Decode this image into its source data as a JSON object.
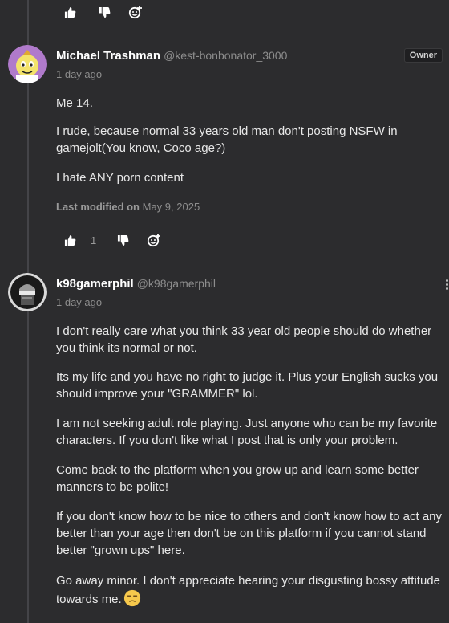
{
  "top_reactions": {
    "like_icon": "thumbs-up-icon",
    "dislike_icon": "thumbs-down-icon",
    "add_reaction_icon": "add-reaction-icon"
  },
  "comments": [
    {
      "display_name": "Michael Trashman",
      "username": "@kest-bonbonator_3000",
      "timestamp": "1 day ago",
      "badge": "Owner",
      "paragraphs": [
        "Me 14.",
        "I rude, because normal 33 years old man don't posting NSFW in gamejolt(You know, Coco age?)",
        "I hate ANY porn content"
      ],
      "modified_label": "Last modified on",
      "modified_date": "May 9, 2025",
      "like_count": "1"
    },
    {
      "display_name": "k98gamerphil",
      "username": "@k98gamerphil",
      "timestamp": "1 day ago",
      "paragraphs": [
        "I don't really care what you think 33 year old people should do whether you think its normal or not.",
        "Its my life and you have no right to judge it. Plus your English sucks you should improve your \"GRAMMER\" lol.",
        "I am not seeking adult role playing. Just anyone who can be my favorite characters. If you don't like what I post that is only your problem.",
        "Come back to the platform when you grow up and learn some better manners to be polite!",
        "If you don't know how to be nice to others and don't know how to act any better than your age then don't be on this platform if you cannot stand better \"grown ups\" here.",
        "Go away minor. I don't appreciate hearing your disgusting bossy attitude towards me."
      ],
      "emoji": "unamused-face-emoji"
    }
  ],
  "colors": {
    "background": "#2c2c2e",
    "text": "#e8e8e8",
    "muted": "#8d8d8d",
    "thread_line": "#444448"
  }
}
